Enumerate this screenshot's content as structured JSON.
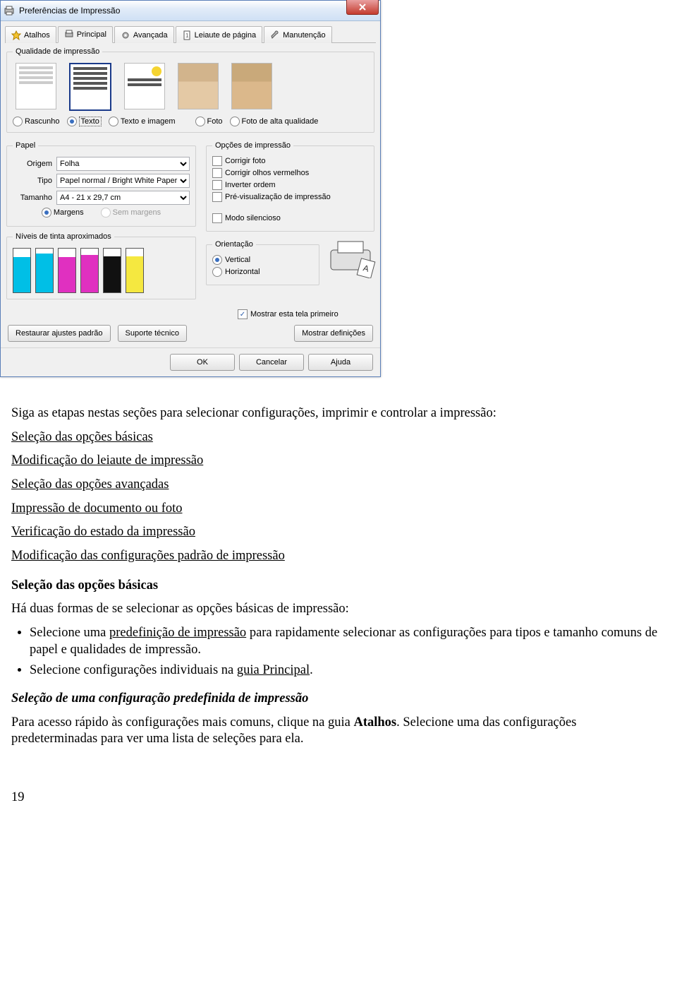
{
  "window": {
    "title": "Preferências de Impressão",
    "tabs": [
      "Atalhos",
      "Principal",
      "Avançada",
      "Leiaute de página",
      "Manutenção"
    ],
    "active_tab": 1
  },
  "quality_group": {
    "legend": "Qualidade de impressão",
    "options": [
      "Rascunho",
      "Texto",
      "Texto e imagem",
      "Foto",
      "Foto de alta qualidade"
    ],
    "selected": 1
  },
  "paper": {
    "legend": "Papel",
    "origin_label": "Origem",
    "origin_value": "Folha",
    "type_label": "Tipo",
    "type_value": "Papel normal / Bright White Paper",
    "size_label": "Tamanho",
    "size_value": "A4 - 21 x 29,7 cm",
    "margins_label": "Margens",
    "noborders_label": "Sem margens"
  },
  "print_options": {
    "legend": "Opções de impressão",
    "items": [
      "Corrigir foto",
      "Corrigir olhos vermelhos",
      "Inverter ordem",
      "Pré-visualização de impressão"
    ],
    "silent": "Modo silencioso"
  },
  "ink": {
    "legend": "Níveis de tinta aproximados",
    "colors": [
      "#00bfe6",
      "#00bfe6",
      "#e030c0",
      "#e030c0",
      "#111111",
      "#f5e840"
    ],
    "heights": [
      80,
      88,
      80,
      85,
      82,
      83
    ]
  },
  "orientation": {
    "legend": "Orientação",
    "vertical": "Vertical",
    "horizontal": "Horizontal"
  },
  "show_first": "Mostrar esta tela primeiro",
  "buttons": {
    "restore": "Restaurar ajustes padrão",
    "support": "Suporte técnico",
    "show_defs": "Mostrar definições",
    "ok": "OK",
    "cancel": "Cancelar",
    "help": "Ajuda"
  },
  "doc": {
    "p1": "Siga as etapas nestas seções para selecionar configurações, imprimir e controlar a impressão:",
    "links": [
      "Seleção das opções básicas",
      "Modificação do leiaute de impressão",
      "Seleção das opções avançadas",
      "Impressão de documento ou foto",
      "Verificação do estado da impressão",
      "Modificação das configurações padrão de impressão"
    ],
    "h2": "Seleção das opções básicas",
    "p2": "Há duas formas de se selecionar as opções básicas de impressão:",
    "li1a": "Selecione uma ",
    "li1link": "predefinição de impressão",
    "li1b": " para rapidamente selecionar as configurações para tipos e tamanho comuns de papel e qualidades de impressão.",
    "li2a": "Selecione configurações individuais na ",
    "li2link": "guia Principal",
    "li2b": ".",
    "h3": "Seleção de uma configuração predefinida de impressão",
    "p3a": "Para acesso rápido às configurações mais comuns, clique na guia ",
    "p3b": "Atalhos",
    "p3c": ". Selecione uma das configurações predeterminadas para ver uma lista de seleções para ela.",
    "page": "19"
  }
}
